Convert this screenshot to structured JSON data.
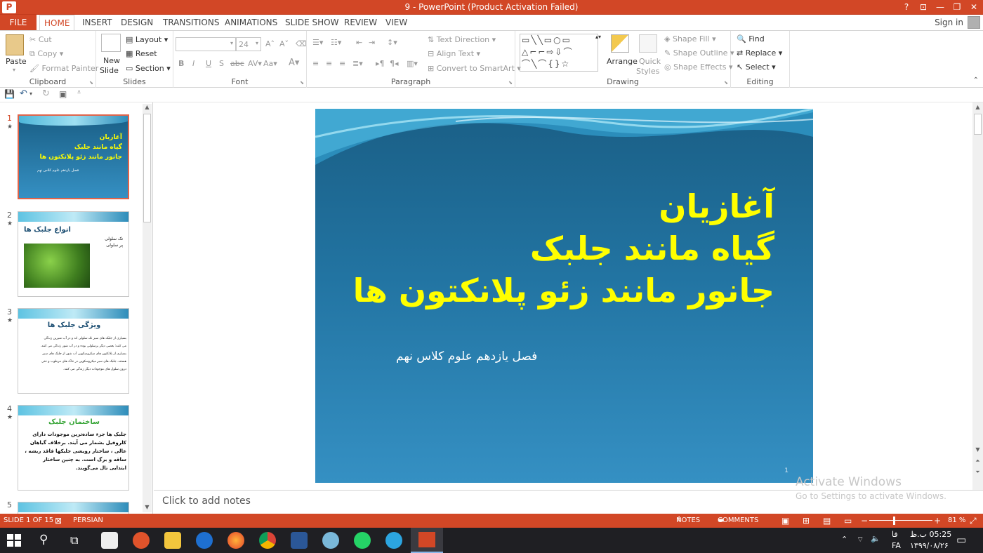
{
  "window": {
    "title": "9  -  PowerPoint (Product Activation Failed)",
    "help": "?",
    "minimize": "—",
    "restore": "❐",
    "close": "✕"
  },
  "tabs": [
    "FILE",
    "HOME",
    "INSERT",
    "DESIGN",
    "TRANSITIONS",
    "ANIMATIONS",
    "SLIDE SHOW",
    "REVIEW",
    "VIEW"
  ],
  "active_tab": "HOME",
  "account": {
    "signin": "Sign in"
  },
  "ribbon": {
    "clipboard": {
      "label": "Clipboard",
      "paste": "Paste",
      "cut": "Cut",
      "copy": "Copy",
      "format_painter": "Format Painter"
    },
    "slides": {
      "label": "Slides",
      "new_slide_1": "New",
      "new_slide_2": "Slide",
      "layout": "Layout",
      "reset": "Reset",
      "section": "Section"
    },
    "font": {
      "label": "Font",
      "size": "24"
    },
    "paragraph": {
      "label": "Paragraph",
      "text_direction": "Text Direction",
      "align_text": "Align Text",
      "convert_smartart": "Convert to SmartArt"
    },
    "drawing": {
      "label": "Drawing",
      "arrange": "Arrange",
      "quick_styles_1": "Quick",
      "quick_styles_2": "Styles",
      "shape_fill": "Shape Fill",
      "shape_outline": "Shape Outline",
      "shape_effects": "Shape Effects"
    },
    "editing": {
      "label": "Editing",
      "find": "Find",
      "replace": "Replace",
      "select": "Select"
    }
  },
  "thumbnails": [
    {
      "num": "1",
      "title_lines": [
        "آغازیان",
        "گیاه مانند جلبک",
        "جانور مانند زئو پلانکتون ها"
      ],
      "sub": "فصل یازدهم علوم کلاس نهم"
    },
    {
      "num": "2",
      "title": "انواع جلبک ها",
      "items": [
        "تک سلولی",
        "پر سلولی"
      ]
    },
    {
      "num": "3",
      "title": "ویژگی جلبک ها",
      "lines": [
        "بسیاری از جلبک های سبز تک سلولی اند و در آب شیرین زندگی",
        "می کنند؛ بعضی دیگر پرسلولی بوده و در آب شور زندگی می کنند.",
        "بسیاری از پلانکتون های میکروسکوپی آب شور از جلبک های سبز",
        "هستند. جلبک های سبز میکروسکوپی در خاک های مرطوب و حتی",
        "درون سلول های موجودات دیگر زندگی می کنند."
      ]
    },
    {
      "num": "4",
      "title": "ساختمان جلبک",
      "lines": [
        "جلبک ها جزء ساده‌ترین موجودات دارای",
        "کلروفیل بشمار می آیند. برخلاف گیاهان",
        "عالی ، ساختار رویشی جلبکها فاقد ریشه ،",
        "ساقه و برگ است. به چنین ساختار",
        "ابتدایی تال می‌گویند."
      ]
    },
    {
      "num": "5"
    }
  ],
  "slide": {
    "title_lines": [
      "آغازیان",
      "گیاه مانند جلبک",
      "جانور مانند زئو پلانکتون ها"
    ],
    "subtitle": "فصل یازدهم علوم کلاس نهم",
    "number": "1"
  },
  "notes": {
    "placeholder": "Click to add notes"
  },
  "watermark": {
    "line1": "Activate Windows",
    "line2": "Go to Settings to activate Windows."
  },
  "status": {
    "slide": "SLIDE 1 OF 15",
    "language": "PERSIAN",
    "notes": "NOTES",
    "comments": "COMMENTS",
    "zoom": "81 %",
    "zoom_minus": "−",
    "zoom_plus": "+"
  },
  "taskbar": {
    "time": "05:25 ب.ظ",
    "date": "۱۳۹۹/۰۸/۲۶",
    "lang_top": "فا",
    "lang_bottom": "FA"
  },
  "colors": {
    "accent": "#d24726",
    "title_yellow": "#ffff00",
    "slide_blue": "#2274a2"
  }
}
